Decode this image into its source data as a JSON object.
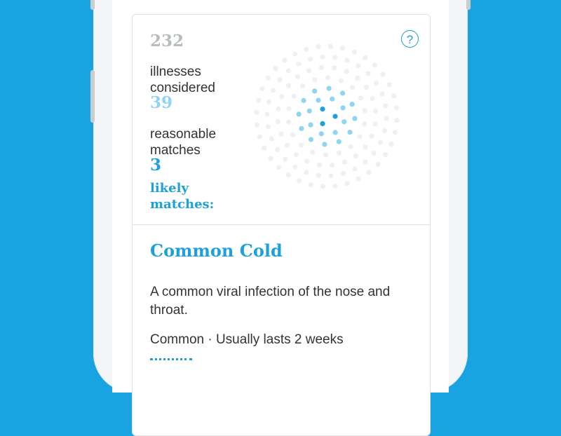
{
  "stats": {
    "considered_count": "232",
    "considered_label": "illnesses considered",
    "reasonable_count": "39",
    "reasonable_label": "reasonable matches",
    "likely_count": "3",
    "likely_label": "likely matches:"
  },
  "help_icon": "?",
  "condition": {
    "title": "Common Cold",
    "description": "A common viral infection of the nose and throat.",
    "meta": "Common · Usually lasts 2 weeks"
  },
  "colors": {
    "background": "#19a3e0",
    "accent": "#1ea0d9",
    "light_accent": "#8fd4f1",
    "muted": "#b8bcbf"
  }
}
